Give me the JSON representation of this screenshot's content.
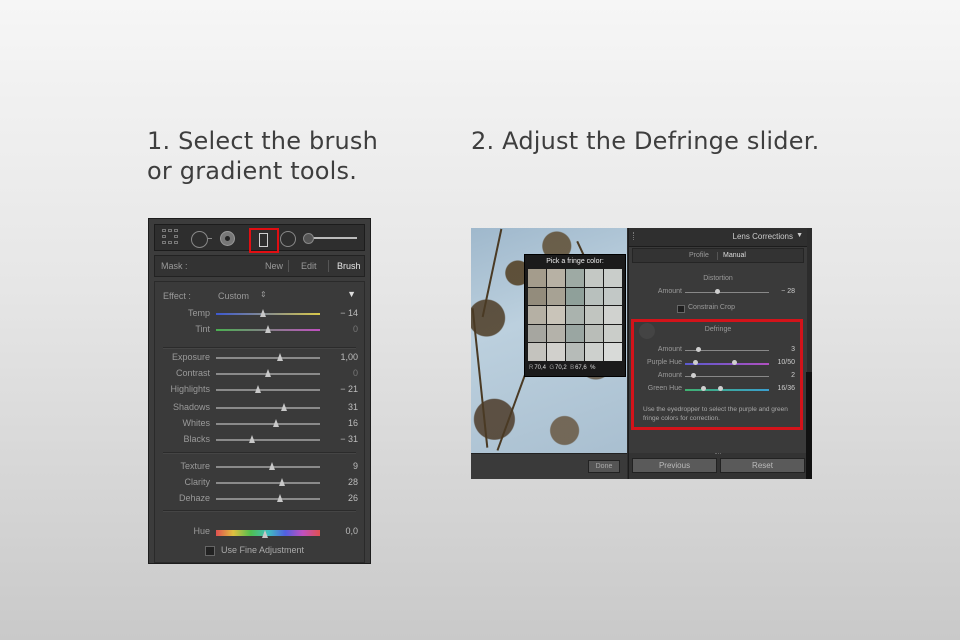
{
  "steps": {
    "one": "1. Select the brush or gradient tools.",
    "two": "2. Adjust the Defringe slider."
  },
  "panel1": {
    "tools": [
      "grid-tool-icon",
      "spot-removal-icon",
      "red-eye-icon",
      "brush-tool-icon",
      "radial-filter-icon",
      "tool-slider-icon"
    ],
    "mask": {
      "label": "Mask :",
      "new": "New",
      "edit": "Edit",
      "brush": "Brush"
    },
    "effect": {
      "label": "Effect :",
      "value": "Custom"
    },
    "sliders": [
      {
        "label": "Temp",
        "value": "− 14",
        "pos": 0.45,
        "track": "temp"
      },
      {
        "label": "Tint",
        "value": "0",
        "pos": 0.5,
        "track": "tint"
      },
      {
        "label": "Exposure",
        "value": "1,00",
        "pos": 0.62
      },
      {
        "label": "Contrast",
        "value": "0",
        "pos": 0.5
      },
      {
        "label": "Highlights",
        "value": "− 21",
        "pos": 0.4
      },
      {
        "label": "Shadows",
        "value": "31",
        "pos": 0.65
      },
      {
        "label": "Whites",
        "value": "16",
        "pos": 0.58
      },
      {
        "label": "Blacks",
        "value": "− 31",
        "pos": 0.35
      },
      {
        "label": "Texture",
        "value": "9",
        "pos": 0.54
      },
      {
        "label": "Clarity",
        "value": "28",
        "pos": 0.63
      },
      {
        "label": "Dehaze",
        "value": "26",
        "pos": 0.62
      },
      {
        "label": "Hue",
        "value": "0,0",
        "pos": 0.47,
        "track": "hue"
      }
    ],
    "fine_adjustment": "Use Fine Adjustment"
  },
  "panel2": {
    "picker": {
      "title": "Pick a fringe color:",
      "rgb": {
        "r_label": "R",
        "r": "70,4",
        "g_label": "G",
        "g": "70,2",
        "b_label": "B",
        "b": "67,6",
        "unit": "%"
      },
      "swatches": [
        "#a49c8c",
        "#b7b1a4",
        "#9eaaa4",
        "#c4c8c4",
        "#c9cdca",
        "#938c7c",
        "#a7a294",
        "#8fa09a",
        "#b8c0bd",
        "#c2c8c6",
        "#b5b0a4",
        "#c9c4b9",
        "#aab3ae",
        "#c1c5c0",
        "#d0d2cf",
        "#a6a6a0",
        "#b4b2aa",
        "#9aa6a2",
        "#b9bdb8",
        "#cacdc9",
        "#c4c3be",
        "#d1d0cc",
        "#b6bbb8",
        "#cdd0cd",
        "#d8dad8"
      ]
    },
    "done": "Done",
    "lens": {
      "title": "Lens Corrections",
      "tab_profile": "Profile",
      "tab_manual": "Manual",
      "distortion": "Distortion",
      "dist_amount": {
        "label": "Amount",
        "value": "− 28",
        "pos": 0.38
      },
      "constrain_crop": "Constrain Crop",
      "defringe": "Defringe",
      "rows": [
        {
          "label": "Amount",
          "value": "3",
          "pos": 0.15,
          "track": "plain"
        },
        {
          "label": "Purple Hue",
          "value": "10/50",
          "pos": 0.12,
          "pos2": 0.58,
          "track": "purple"
        },
        {
          "label": "Amount",
          "value": "2",
          "pos": 0.1,
          "track": "plain"
        },
        {
          "label": "Green Hue",
          "value": "16/36",
          "pos": 0.22,
          "pos2": 0.42,
          "track": "green"
        }
      ],
      "help": "Use the eyedropper to select the purple and green fringe colors for correction.",
      "previous": "Previous",
      "reset": "Reset"
    }
  },
  "colors": {
    "highlight": "#e10e12"
  }
}
